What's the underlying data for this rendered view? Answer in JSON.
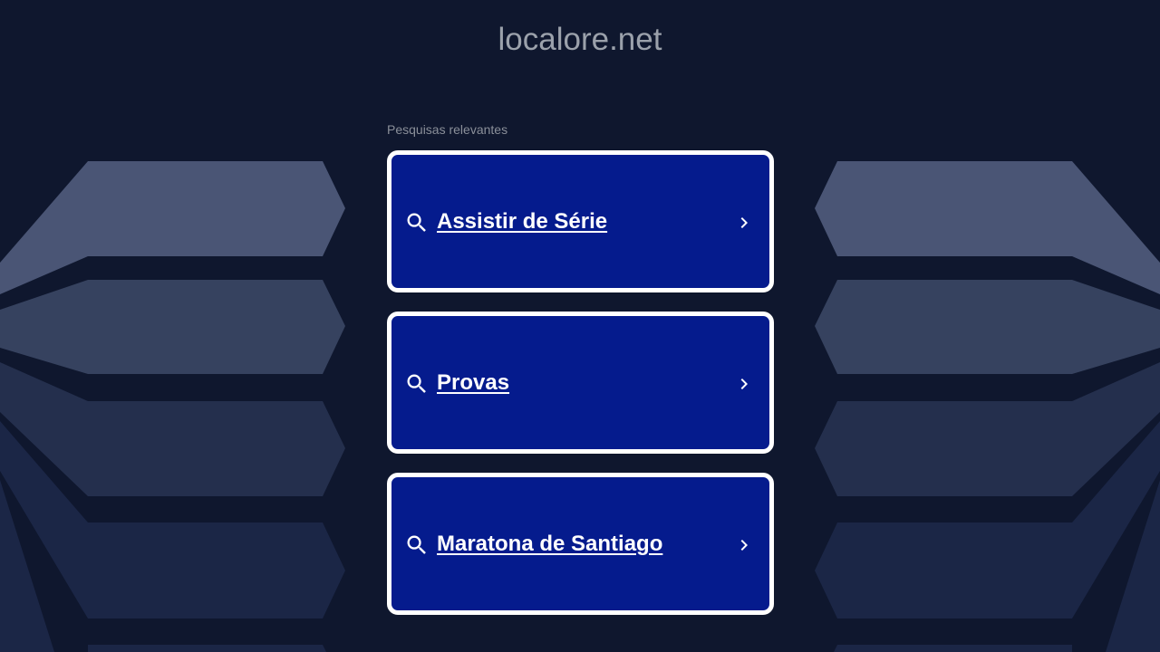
{
  "header": {
    "site_title": "localore.net"
  },
  "main": {
    "section_label": "Pesquisas relevantes",
    "results": [
      {
        "label": "Assistir de Série"
      },
      {
        "label": "Provas"
      },
      {
        "label": "Maratona de Santiago"
      }
    ]
  },
  "colors": {
    "background": "#0f172e",
    "card_background": "#051b8d",
    "card_border": "#ffffff",
    "title_text": "#9ba1ab"
  },
  "icons": {
    "search": "search-icon",
    "chevron": "chevron-right-icon"
  }
}
